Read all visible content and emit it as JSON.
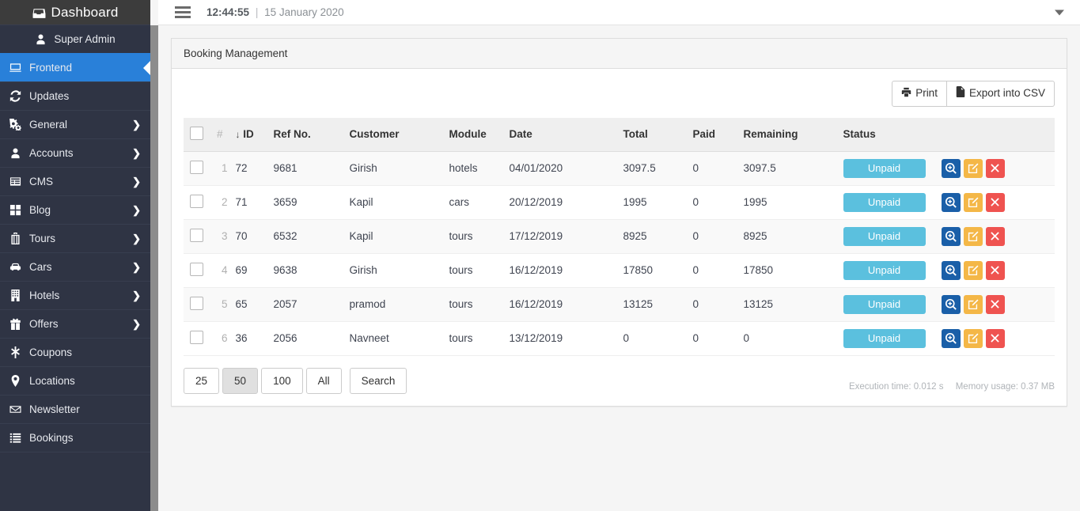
{
  "sidebar": {
    "brand": {
      "label": "Dashboard",
      "icon": "inbox-icon"
    },
    "items": [
      {
        "label": "Super Admin",
        "icon": "user-icon",
        "caret": false,
        "active": false,
        "centered": true
      },
      {
        "label": "Frontend",
        "icon": "desktop-icon",
        "caret": false,
        "active": true,
        "centered": false
      },
      {
        "label": "Updates",
        "icon": "refresh-icon",
        "caret": false,
        "active": false,
        "centered": false
      },
      {
        "label": "General",
        "icon": "gears-icon",
        "caret": true,
        "active": false,
        "centered": false
      },
      {
        "label": "Accounts",
        "icon": "user-icon",
        "caret": true,
        "active": false,
        "centered": false
      },
      {
        "label": "CMS",
        "icon": "table-icon",
        "caret": true,
        "active": false,
        "centered": false
      },
      {
        "label": "Blog",
        "icon": "grid-icon",
        "caret": true,
        "active": false,
        "centered": false
      },
      {
        "label": "Tours",
        "icon": "suitcase-icon",
        "caret": true,
        "active": false,
        "centered": false
      },
      {
        "label": "Cars",
        "icon": "car-icon",
        "caret": true,
        "active": false,
        "centered": false
      },
      {
        "label": "Hotels",
        "icon": "building-icon",
        "caret": true,
        "active": false,
        "centered": false
      },
      {
        "label": "Offers",
        "icon": "gift-icon",
        "caret": true,
        "active": false,
        "centered": false
      },
      {
        "label": "Coupons",
        "icon": "asterisk-icon",
        "caret": false,
        "active": false,
        "centered": false
      },
      {
        "label": "Locations",
        "icon": "map-pin-icon",
        "caret": false,
        "active": false,
        "centered": false
      },
      {
        "label": "Newsletter",
        "icon": "envelope-icon",
        "caret": false,
        "active": false,
        "centered": false
      },
      {
        "label": "Bookings",
        "icon": "list-icon",
        "caret": false,
        "active": false,
        "centered": false
      }
    ],
    "colors": {
      "background": "#2f3444",
      "active": "#2980d9",
      "brand_bar": "#3c3c3c"
    }
  },
  "topbar": {
    "menu_icon": "hamburger-icon",
    "time": "12:44:55",
    "separator": "|",
    "date": "15 January 2020",
    "user_menu_icon": "caret-down-icon"
  },
  "panel": {
    "title": "Booking Management"
  },
  "toolbar": {
    "print_label": "Print",
    "print_icon": "printer-icon",
    "export_label": "Export into CSV",
    "export_icon": "file-icon"
  },
  "table": {
    "select_all_checkbox": "",
    "columns": [
      "#",
      "ID",
      "Ref No.",
      "Customer",
      "Module",
      "Date",
      "Total",
      "Paid",
      "Remaining",
      "Status"
    ],
    "sort_indicator": "↓",
    "sorted_column": "ID",
    "rows": [
      {
        "num": "1",
        "id": "72",
        "ref": "9681",
        "customer": "Girish",
        "module": "hotels",
        "date": "04/01/2020",
        "total": "3097.5",
        "paid": "0",
        "remaining": "3097.5",
        "status": "Unpaid"
      },
      {
        "num": "2",
        "id": "71",
        "ref": "3659",
        "customer": "Kapil",
        "module": "cars",
        "date": "20/12/2019",
        "total": "1995",
        "paid": "0",
        "remaining": "1995",
        "status": "Unpaid"
      },
      {
        "num": "3",
        "id": "70",
        "ref": "6532",
        "customer": "Kapil",
        "module": "tours",
        "date": "17/12/2019",
        "total": "8925",
        "paid": "0",
        "remaining": "8925",
        "status": "Unpaid"
      },
      {
        "num": "4",
        "id": "69",
        "ref": "9638",
        "customer": "Girish",
        "module": "tours",
        "date": "16/12/2019",
        "total": "17850",
        "paid": "0",
        "remaining": "17850",
        "status": "Unpaid"
      },
      {
        "num": "5",
        "id": "65",
        "ref": "2057",
        "customer": "pramod",
        "module": "tours",
        "date": "16/12/2019",
        "total": "13125",
        "paid": "0",
        "remaining": "13125",
        "status": "Unpaid"
      },
      {
        "num": "6",
        "id": "36",
        "ref": "2056",
        "customer": "Navneet",
        "module": "tours",
        "date": "13/12/2019",
        "total": "0",
        "paid": "0",
        "remaining": "0",
        "status": "Unpaid"
      }
    ],
    "row_actions": [
      {
        "name": "view-button",
        "icon": "search-plus-icon",
        "color": "#1a5fa8"
      },
      {
        "name": "edit-button",
        "icon": "pencil-square-icon",
        "color": "#f4b747"
      },
      {
        "name": "delete-button",
        "icon": "times-icon",
        "color": "#ef5350"
      }
    ],
    "status_color": "#5bc0de"
  },
  "pager": {
    "options": [
      "25",
      "50",
      "100",
      "All"
    ],
    "selected": "50",
    "search_label": "Search"
  },
  "metrics": {
    "execution_time": "Execution time: 0.012 s",
    "memory_usage": "Memory usage: 0.37 MB"
  }
}
